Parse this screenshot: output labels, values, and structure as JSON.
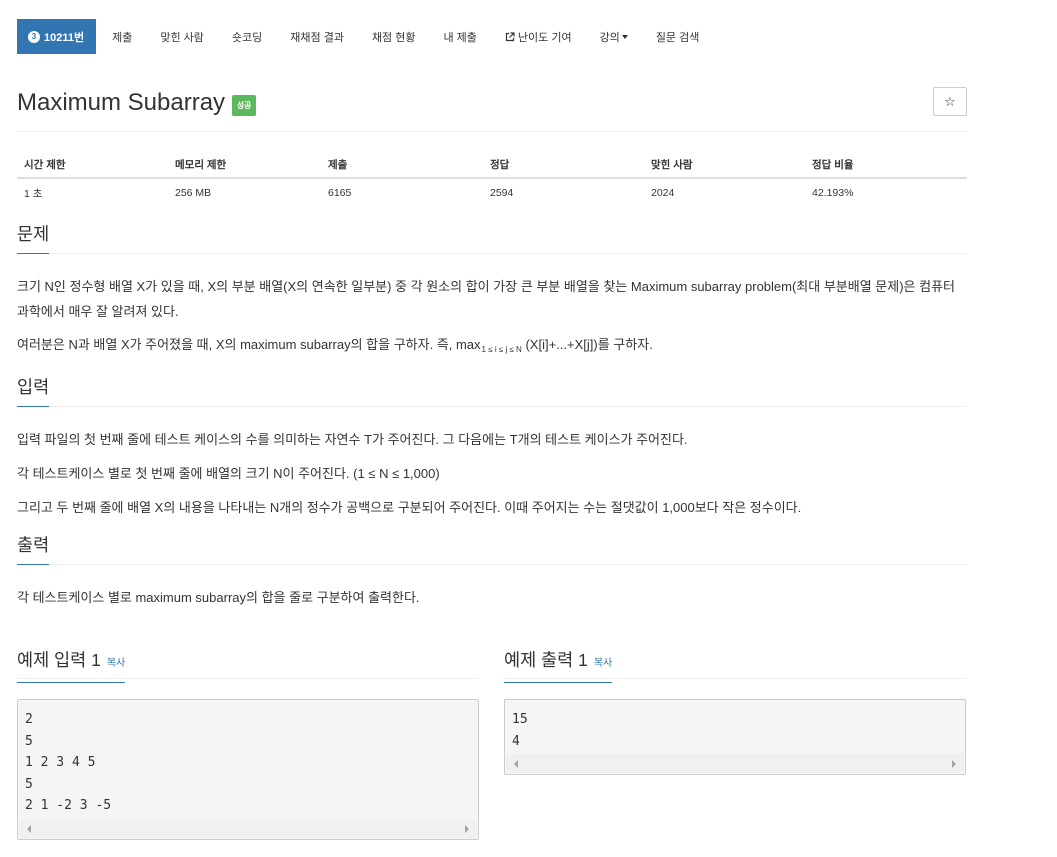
{
  "nav": {
    "problem_badge": "3",
    "problem_id": "10211번",
    "items": [
      "제출",
      "맞힌 사람",
      "숏코딩",
      "재채점 결과",
      "채점 현황",
      "내 제출",
      "난이도 기여",
      "강의",
      "질문 검색"
    ],
    "icons": {
      "external": "external-link-icon",
      "caret": "caret-down-icon",
      "badge": "tier-badge-icon"
    }
  },
  "problem": {
    "title": "Maximum Subarray",
    "status_label": "성공",
    "star_button": "☆"
  },
  "stats": {
    "headers": [
      "시간 제한",
      "메모리 제한",
      "제출",
      "정답",
      "맞힌 사람",
      "정답 비율"
    ],
    "values": [
      "1 초",
      "256 MB",
      "6165",
      "2594",
      "2024",
      "42.193%"
    ]
  },
  "sections": {
    "problem_head": "문제",
    "problem_p1": "크기 N인 정수형 배열 X가 있을 때, X의 부분 배열(X의 연속한 일부분) 중 각 원소의 합이 가장 큰 부분 배열을 찾는 Maximum subarray problem(최대 부분배열 문제)은 컴퓨터 과학에서 매우 잘 알려져 있다.",
    "problem_p2_a": "여러분은 N과 배열 X가 주어졌을 때, X의 maximum subarray의 합을 구하자. 즉, max",
    "problem_p2_sub": "1 ≤ i ≤  j ≤ N",
    "problem_p2_b": " (X[i]+...+X[j])를 구하자.",
    "input_head": "입력",
    "input_p1": "입력 파일의 첫 번째 줄에 테스트 케이스의 수를 의미하는 자연수 T가 주어진다. 그 다음에는 T개의 테스트 케이스가 주어진다.",
    "input_p2": "각 테스트케이스 별로 첫 번째 줄에 배열의 크기 N이 주어진다. (1 ≤ N ≤ 1,000)",
    "input_p3": "그리고 두 번째 줄에 배열 X의 내용을 나타내는 N개의 정수가 공백으로 구분되어 주어진다. 이때 주어지는 수는 절댓값이 1,000보다 작은 정수이다.",
    "output_head": "출력",
    "output_p1": "각 테스트케이스 별로 maximum subarray의 합을 줄로 구분하여 출력한다."
  },
  "samples": {
    "input_title": "예제 입력 1",
    "output_title": "예제 출력 1",
    "copy_label": "복사",
    "input_text": "2\n5\n1 2 3 4 5\n5\n2 1 -2 3 -5",
    "output_text": "15\n4"
  },
  "colors": {
    "primary": "#3276b1",
    "success": "#5cb85c"
  }
}
